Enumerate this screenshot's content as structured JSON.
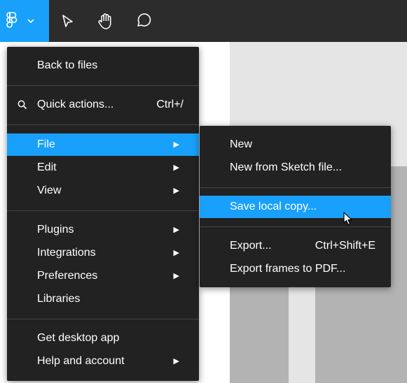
{
  "toolbar": {
    "logo_icon": "figma-logo-icon",
    "tools": [
      "move-pointer-icon",
      "hand-icon",
      "comment-icon"
    ],
    "accent": "#18a0fb"
  },
  "main_menu": {
    "back_to_files": "Back to files",
    "quick_actions": "Quick actions...",
    "quick_actions_shortcut": "Ctrl+/",
    "file": "File",
    "edit": "Edit",
    "view": "View",
    "plugins": "Plugins",
    "integrations": "Integrations",
    "preferences": "Preferences",
    "libraries": "Libraries",
    "get_desktop_app": "Get desktop app",
    "help_and_account": "Help and account"
  },
  "file_submenu": {
    "new": "New",
    "new_from_sketch": "New from Sketch file...",
    "save_local_copy": "Save local copy...",
    "export": "Export...",
    "export_shortcut": "Ctrl+Shift+E",
    "export_frames_pdf": "Export frames to PDF..."
  }
}
